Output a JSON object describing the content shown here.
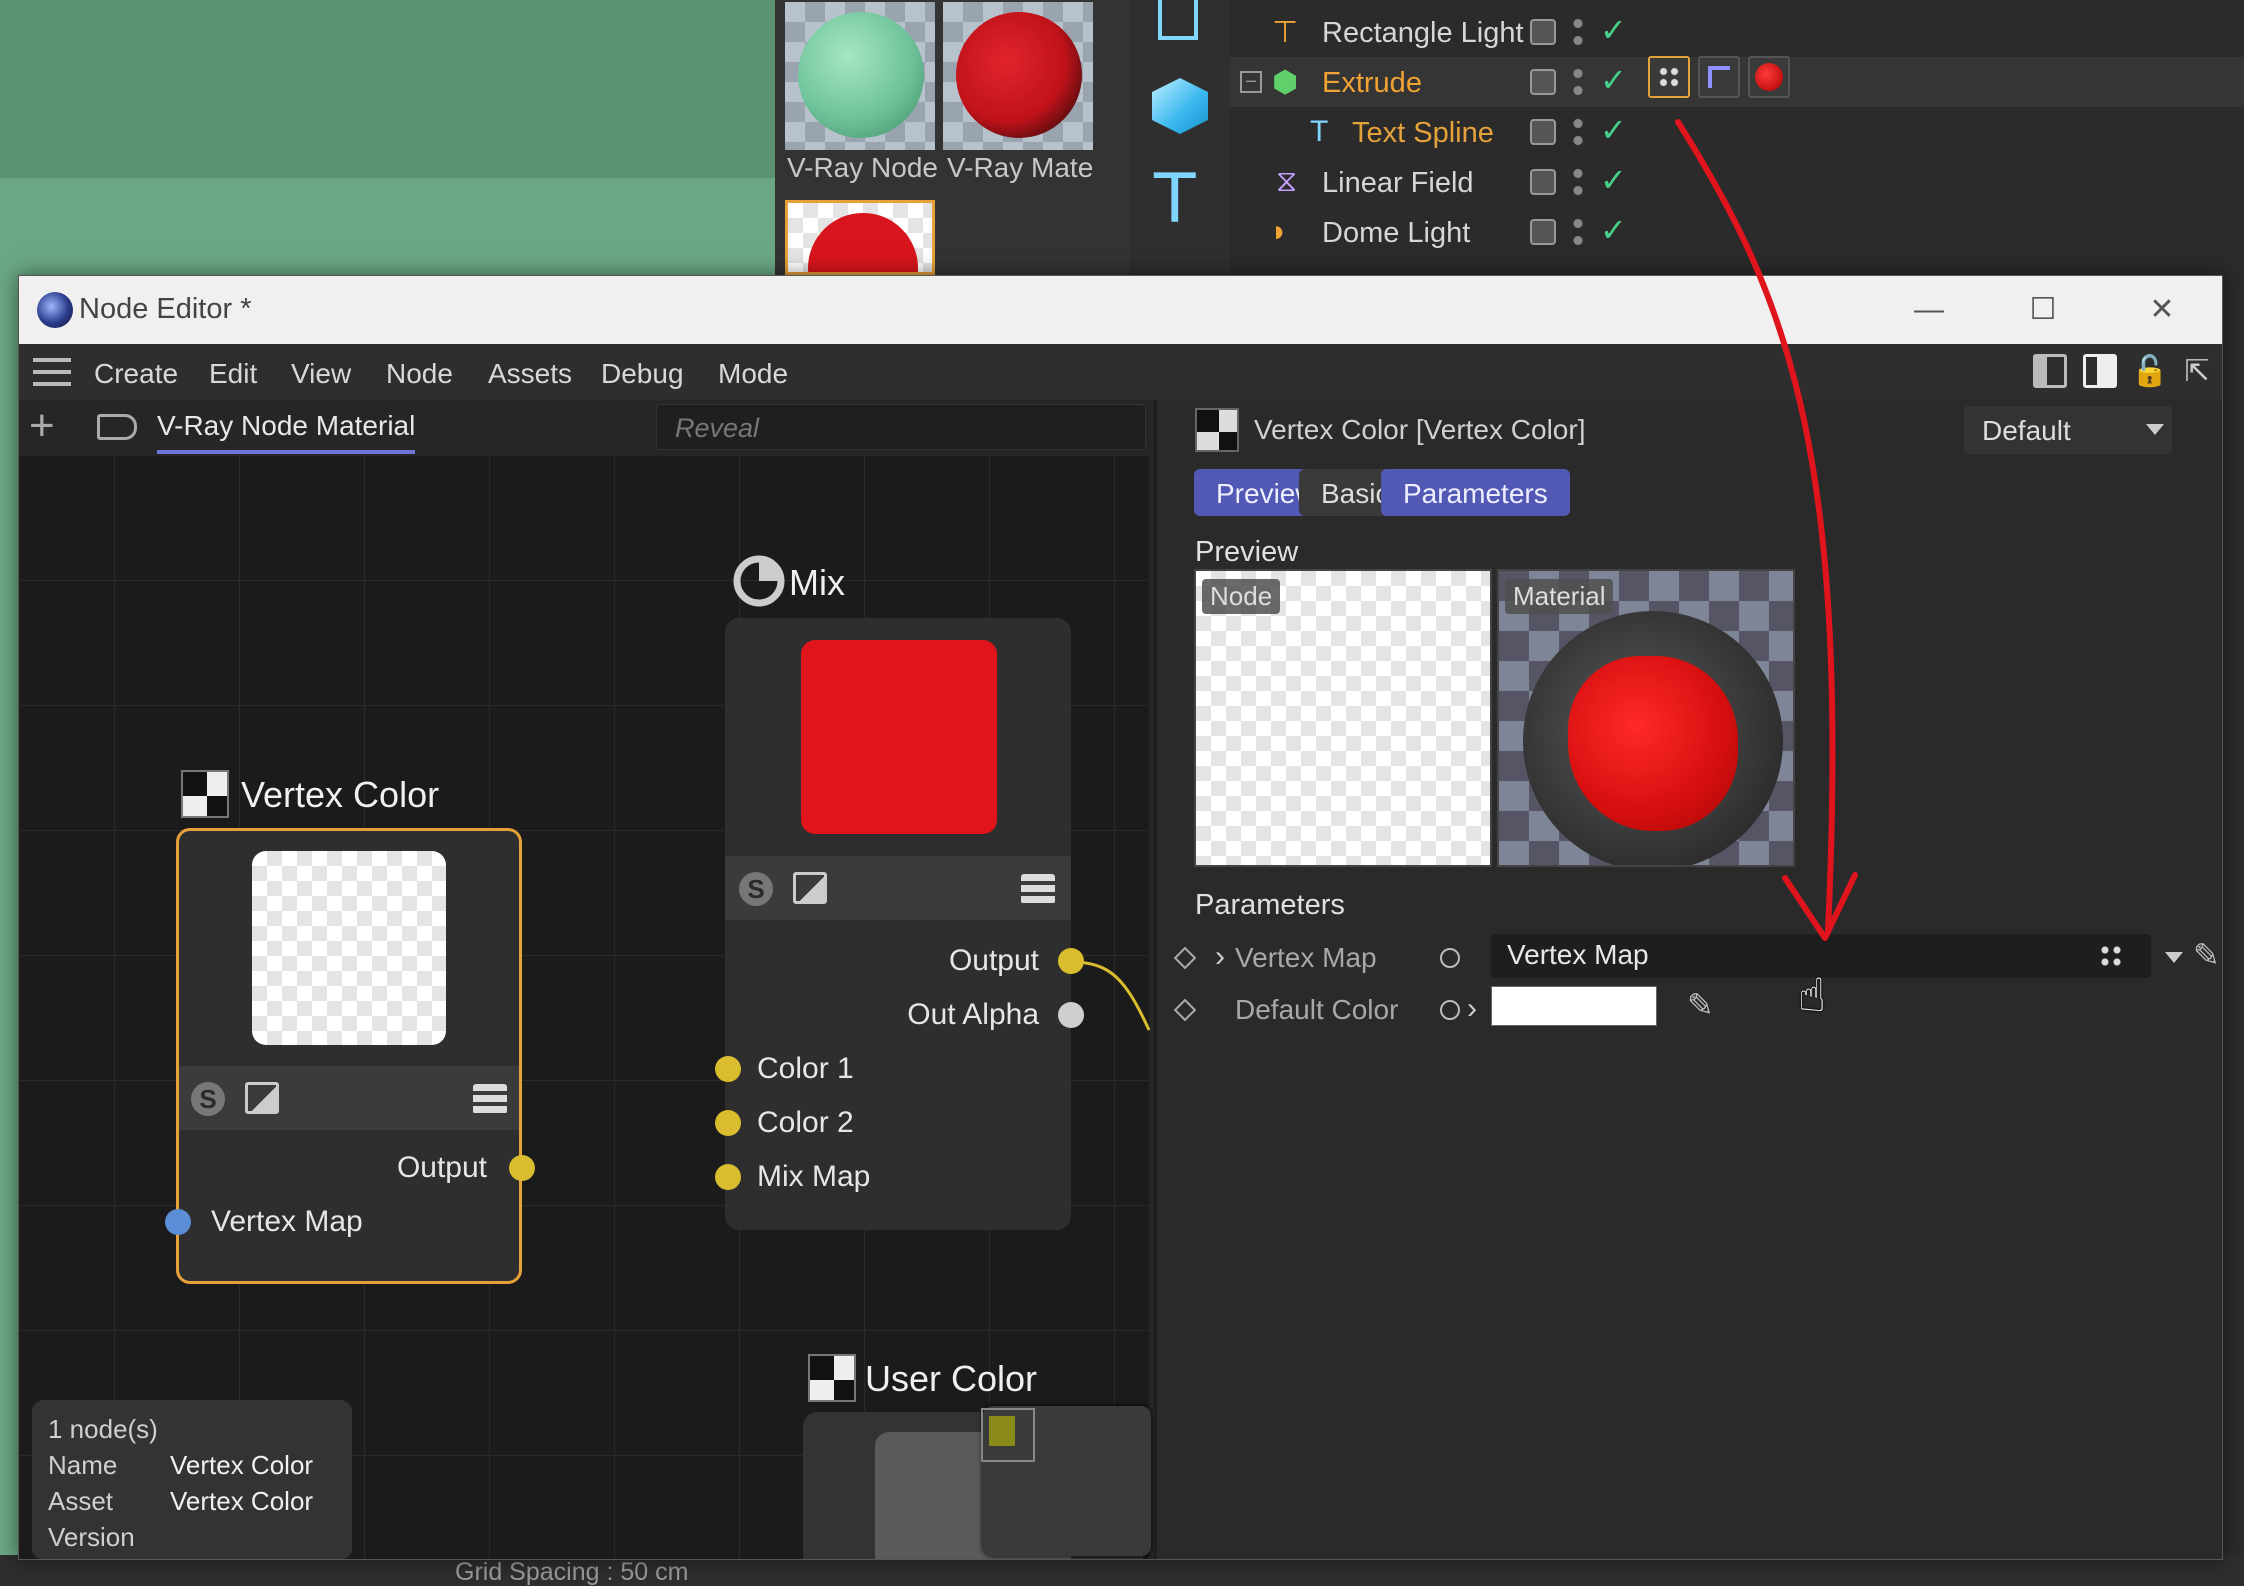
{
  "background": {
    "material_browser": {
      "thumbs": [
        {
          "label": "V-Ray Node",
          "ball_color": "#6fc39a"
        },
        {
          "label": "V-Ray Mate",
          "ball_color": "#c0121a"
        }
      ]
    },
    "object_manager": {
      "objects": [
        {
          "name": "Rectangle Light",
          "icon": "rectangle-light-icon",
          "selected": false
        },
        {
          "name": "Extrude",
          "icon": "extrude-icon",
          "selected": true
        },
        {
          "name": "Text Spline",
          "icon": "text-spline-icon",
          "selected": false
        },
        {
          "name": "Linear Field",
          "icon": "linear-field-icon",
          "selected": false
        },
        {
          "name": "Dome Light",
          "icon": "dome-light-icon",
          "selected": false
        }
      ]
    },
    "grid_spacing": "Grid Spacing : 50 cm"
  },
  "window": {
    "title": "Node Editor *",
    "controls": {
      "minimize": "—",
      "maximize": "☐",
      "close": "✕"
    }
  },
  "menu": {
    "items": [
      "Create",
      "Edit",
      "View",
      "Node",
      "Assets",
      "Debug",
      "Mode"
    ]
  },
  "graph": {
    "tab_label": "V-Ray Node Material",
    "reveal_placeholder": "Reveal",
    "nodes": {
      "vertex_color": {
        "title": "Vertex Color",
        "outputs": [
          "Output"
        ],
        "inputs": [
          "Vertex Map"
        ]
      },
      "mix": {
        "title": "Mix",
        "preview_color": "#e0151b",
        "outputs": [
          "Output",
          "Out Alpha"
        ],
        "inputs": [
          "Color 1",
          "Color 2",
          "Mix Map"
        ]
      },
      "user_color": {
        "title": "User Color"
      }
    },
    "info": {
      "count": "1 node(s)",
      "rows": [
        {
          "key": "Name",
          "value": "Vertex Color"
        },
        {
          "key": "Asset",
          "value": "Vertex Color"
        },
        {
          "key": "Version",
          "value": ""
        }
      ]
    }
  },
  "attributes": {
    "title": "Vertex Color [Vertex Color]",
    "preset": "Default",
    "tabs": [
      {
        "label": "Preview",
        "active": true
      },
      {
        "label": "Basic",
        "active": false
      },
      {
        "label": "Parameters",
        "active": true
      }
    ],
    "preview_section": "Preview",
    "preview_tags": {
      "node": "Node",
      "material": "Material"
    },
    "parameters_section": "Parameters",
    "params": [
      {
        "label": "Vertex Map",
        "value": "Vertex Map"
      },
      {
        "label": "Default Color",
        "value": "#ffffff"
      }
    ]
  },
  "colors": {
    "accent": "#5259b5",
    "selection": "#e6a23a",
    "port_yellow": "#d9bd2e",
    "port_blue": "#5c8ed8",
    "annotation_arrow": "#e0141c"
  }
}
